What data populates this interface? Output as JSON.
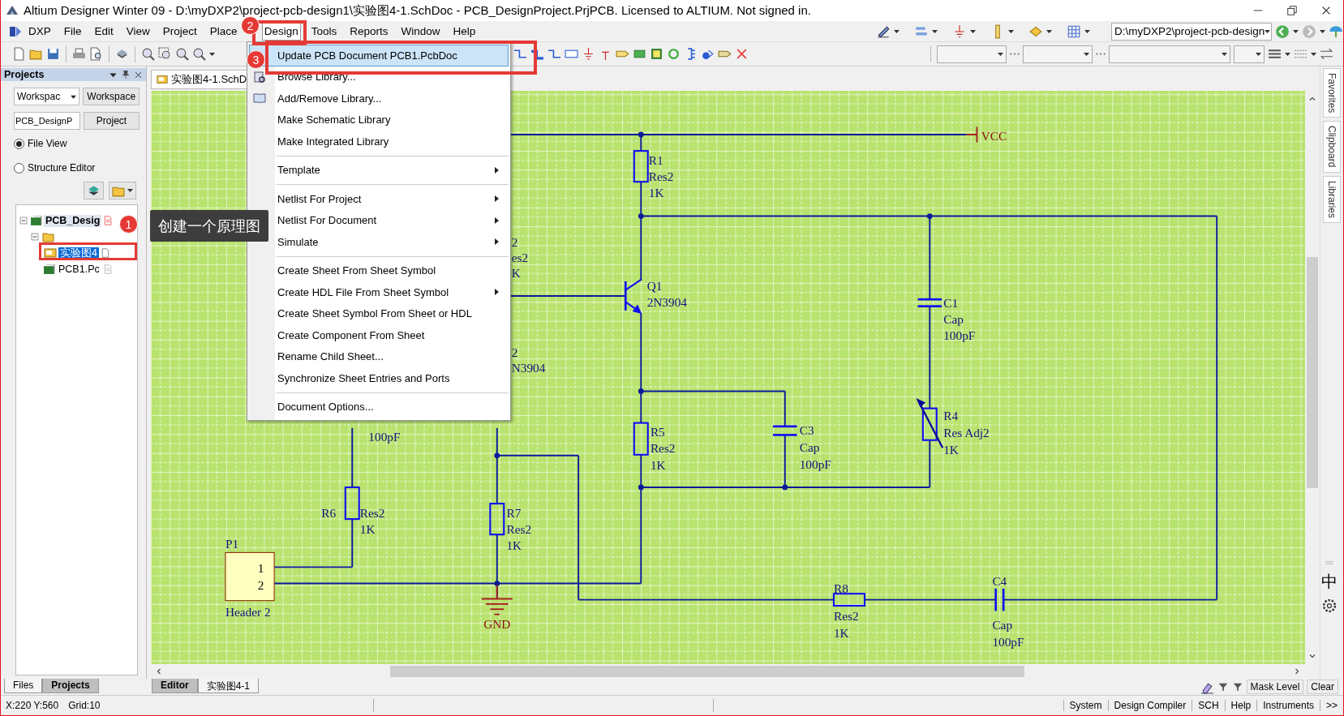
{
  "window": {
    "title": "Altium Designer Winter 09 - D:\\myDXP2\\project-pcb-design1\\实验图4-1.SchDoc - PCB_DesignProject.PrjPCB. Licensed to ALTIUM. Not signed in."
  },
  "menu_bar": [
    {
      "label": "DXP",
      "selected": false
    },
    {
      "label": "File",
      "selected": false
    },
    {
      "label": "Edit",
      "selected": false
    },
    {
      "label": "View",
      "selected": false
    },
    {
      "label": "Project",
      "selected": false
    },
    {
      "label": "Place",
      "selected": false
    },
    {
      "label": "Design",
      "selected": true
    },
    {
      "label": "Tools",
      "selected": false
    },
    {
      "label": "Reports",
      "selected": false
    },
    {
      "label": "Window",
      "selected": false
    },
    {
      "label": "Help",
      "selected": false
    }
  ],
  "path_combo": {
    "value": "D:\\myDXP2\\project-pcb-design"
  },
  "design_menu": [
    {
      "kind": "item",
      "label": "Update PCB Document PCB1.PcbDoc",
      "selected": true,
      "submenu": false
    },
    {
      "kind": "item",
      "label": "Browse Library...",
      "selected": false,
      "submenu": false
    },
    {
      "kind": "item",
      "label": "Add/Remove Library...",
      "selected": false,
      "submenu": false
    },
    {
      "kind": "item",
      "label": "Make Schematic Library",
      "selected": false,
      "submenu": false
    },
    {
      "kind": "item",
      "label": "Make Integrated Library",
      "selected": false,
      "submenu": false
    },
    {
      "kind": "separator"
    },
    {
      "kind": "item",
      "label": "Template",
      "selected": false,
      "submenu": true
    },
    {
      "kind": "separator"
    },
    {
      "kind": "item",
      "label": "Netlist For Project",
      "selected": false,
      "submenu": true
    },
    {
      "kind": "item",
      "label": "Netlist For Document",
      "selected": false,
      "submenu": true
    },
    {
      "kind": "item",
      "label": "Simulate",
      "selected": false,
      "submenu": true
    },
    {
      "kind": "separator"
    },
    {
      "kind": "item",
      "label": "Create Sheet From Sheet Symbol",
      "selected": false,
      "submenu": false
    },
    {
      "kind": "item",
      "label": "Create HDL File From Sheet Symbol",
      "selected": false,
      "submenu": true
    },
    {
      "kind": "item",
      "label": "Create Sheet Symbol From Sheet or HDL",
      "selected": false,
      "submenu": false
    },
    {
      "kind": "item",
      "label": "Create Component From Sheet",
      "selected": false,
      "submenu": false
    },
    {
      "kind": "item",
      "label": "Rename Child Sheet...",
      "selected": false,
      "submenu": false
    },
    {
      "kind": "item",
      "label": "Synchronize Sheet Entries and Ports",
      "selected": false,
      "submenu": false
    },
    {
      "kind": "separator"
    },
    {
      "kind": "item",
      "label": "Document Options...",
      "selected": false,
      "submenu": false
    }
  ],
  "projects_panel": {
    "title": "Projects",
    "workspace_combo": {
      "value": "Workspac"
    },
    "workspace_button": "Workspace",
    "project_field": {
      "value": "PCB_DesignP"
    },
    "project_button": "Project",
    "views": [
      {
        "label": "File View",
        "selected": true
      },
      {
        "label": "Structure Editor",
        "selected": false
      }
    ],
    "tree": [
      {
        "label": "PCB_Desig",
        "expanded": true,
        "children": [
          {
            "expanded": true,
            "children": [
              {
                "label": "实验图4",
                "selected": true
              },
              {
                "label": "PCB1.Pc",
                "selected": false
              }
            ]
          }
        ]
      }
    ]
  },
  "panel_tabs": [
    {
      "label": "Files",
      "selected": false
    },
    {
      "label": "Projects",
      "selected": true
    }
  ],
  "document_tabs": [
    {
      "label": "实验图4-1.SchD",
      "selected": true
    }
  ],
  "schematic": {
    "components": [
      {
        "kind": "resistor",
        "designator": "R1",
        "comment": "Res2",
        "value": "1K"
      },
      {
        "kind": "transistor",
        "designator": "Q1",
        "comment": "2N3904"
      },
      {
        "kind": "capacitor",
        "designator": "C1",
        "comment": "Cap",
        "value": "100pF"
      },
      {
        "kind": "variable-resistor",
        "designator": "R4",
        "comment": "Res Adj2",
        "value": "1K"
      },
      {
        "kind": "resistor",
        "designator": "R5",
        "comment": "Res2",
        "value": "1K"
      },
      {
        "kind": "capacitor",
        "designator": "C3",
        "comment": "Cap",
        "value": "100pF"
      },
      {
        "kind": "resistor",
        "designator": "R6",
        "comment": "Res2",
        "value": "1K"
      },
      {
        "kind": "resistor",
        "designator": "R7",
        "comment": "Res2",
        "value": "1K"
      },
      {
        "kind": "resistor",
        "designator": "R8",
        "comment": "Res2",
        "value": "1K"
      },
      {
        "kind": "capacitor",
        "designator": "C4",
        "comment": "Cap",
        "value": "100pF"
      },
      {
        "kind": "header",
        "designator": "P1",
        "comment": "Header 2",
        "pins": [
          "1",
          "2"
        ]
      }
    ],
    "power_ports": [
      {
        "kind": "vcc",
        "label": "VCC"
      },
      {
        "kind": "gnd",
        "label": "GND"
      }
    ],
    "obscured_labels": [
      "2",
      "es2",
      "K",
      "2",
      "N3904",
      "100pF"
    ]
  },
  "editor_tabs": [
    {
      "label": "Editor",
      "selected": true
    },
    {
      "label": "实验图4-1",
      "selected": false
    }
  ],
  "dock_tabs": [
    "Favorites",
    "Clipboard",
    "Libraries"
  ],
  "mask": {
    "mask_level": "Mask Level",
    "clear": "Clear"
  },
  "ime": {
    "mode": "中"
  },
  "annotations": [
    {
      "number": "1",
      "text": "创建一个原理图"
    },
    {
      "number": "2"
    },
    {
      "number": "3"
    }
  ],
  "status_bar": {
    "coordinates": "X:220 Y:560",
    "grid": "Grid:10",
    "panels": [
      "System",
      "Design Compiler",
      "SCH",
      "Help",
      "Instruments",
      ">>"
    ]
  }
}
